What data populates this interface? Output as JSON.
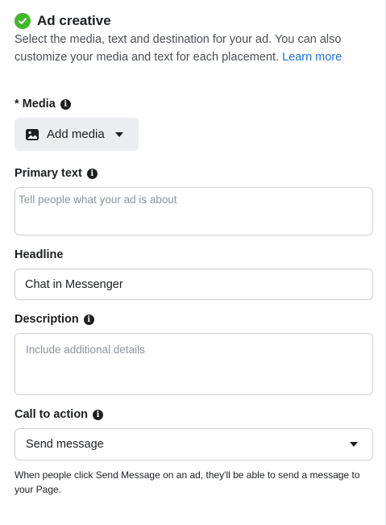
{
  "header": {
    "title": "Ad creative",
    "subtitle": "Select the media, text and destination for your ad. You can also customize your media and text for each placement.",
    "learn_more": "Learn more"
  },
  "media": {
    "label": "* Media",
    "button_label": "Add media"
  },
  "primary_text": {
    "label": "Primary text",
    "placeholder": "Tell people what your ad is about"
  },
  "headline": {
    "label": "Headline",
    "value": "Chat in Messenger"
  },
  "description": {
    "label": "Description",
    "placeholder": "Include additional details"
  },
  "call_to_action": {
    "label": "Call to action",
    "selected": "Send message",
    "help": "When people click Send Message on an ad, they'll be able to send a message to your Page."
  },
  "icons": {
    "status": "check-circle-icon",
    "info": "info-icon",
    "media": "photo-icon",
    "dropdown": "caret-down-icon"
  },
  "colors": {
    "success": "#42b72a",
    "link": "#216fdb",
    "border": "#ccd0d5",
    "button_bg": "#ebedf0"
  }
}
